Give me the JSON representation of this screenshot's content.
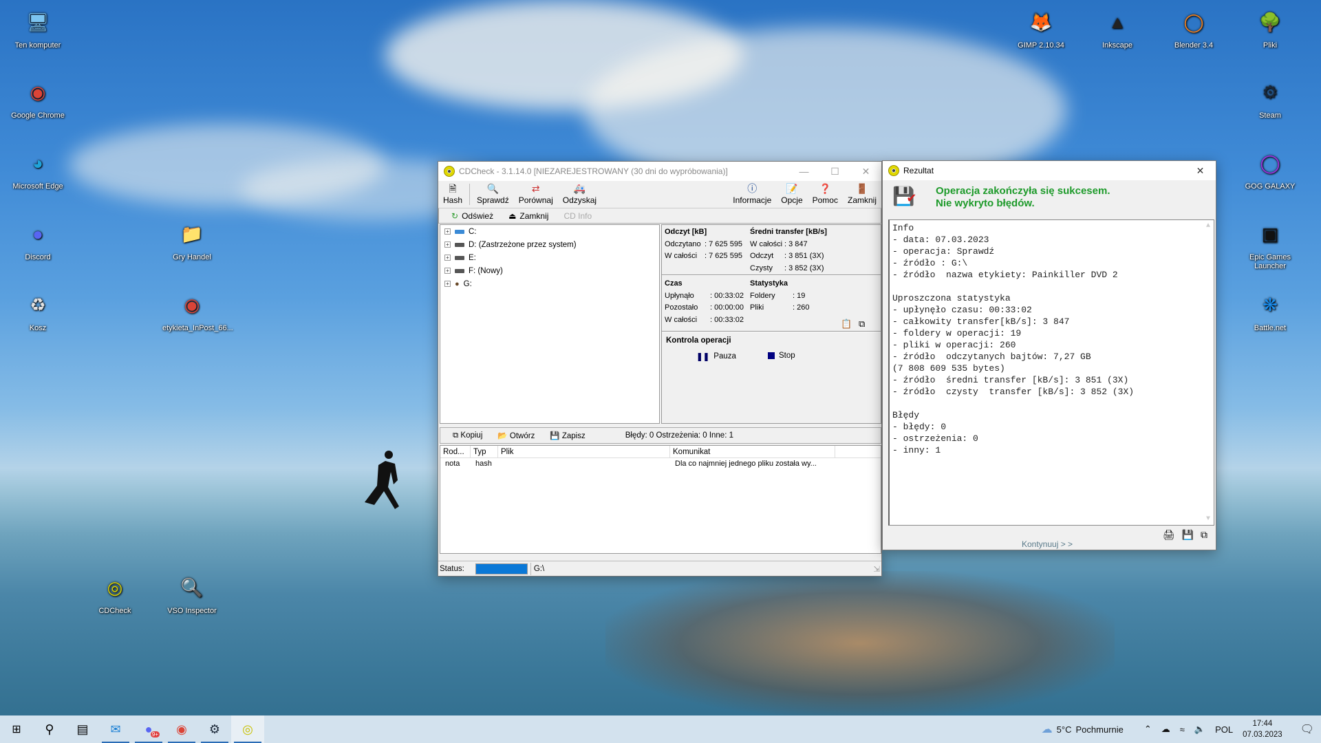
{
  "desktop": {
    "icons_left": [
      {
        "label": "Ten komputer",
        "icon": "computer-icon"
      },
      {
        "label": "Google Chrome",
        "icon": "chrome-icon"
      },
      {
        "label": "Microsoft Edge",
        "icon": "edge-icon"
      },
      {
        "label": "Discord",
        "icon": "discord-icon"
      },
      {
        "label": "Kosz",
        "icon": "recycle-bin-icon"
      },
      {
        "label": "Gry Handel",
        "icon": "folder-icon"
      },
      {
        "label": "etykieta_InPost_66...",
        "icon": "chrome-icon"
      },
      {
        "label": "CDCheck",
        "icon": "cdcheck-icon"
      },
      {
        "label": "VSO Inspector",
        "icon": "vso-inspector-icon"
      }
    ],
    "icons_right": [
      {
        "label": "GIMP 2.10.34",
        "icon": "gimp-icon"
      },
      {
        "label": "Inkscape",
        "icon": "inkscape-icon"
      },
      {
        "label": "Blender 3.4",
        "icon": "blender-icon"
      },
      {
        "label": "Pliki",
        "icon": "tree-folder-icon"
      },
      {
        "label": "Steam",
        "icon": "steam-icon"
      },
      {
        "label": "GOG GALAXY",
        "icon": "gog-galaxy-icon"
      },
      {
        "label": "Epic Games Launcher",
        "icon": "epic-games-icon"
      },
      {
        "label": "Battle.net",
        "icon": "battlenet-icon"
      }
    ]
  },
  "main_window": {
    "title": "CDCheck - 3.1.14.0 [NIEZAREJESTROWANY (30 dni do wypróbowania)]",
    "toolbar_left": [
      "Hash",
      "Sprawdź",
      "Porównaj",
      "Odzyskaj"
    ],
    "toolbar_right": [
      "Informacje",
      "Opcje",
      "Pomoc",
      "Zamknij"
    ],
    "subbar": {
      "refresh": "Odśwież",
      "close": "Zamknij",
      "cdinfo": "CD Info"
    },
    "drives": [
      "C:",
      "D: (Zastrzeżone przez system)",
      "E:",
      "F: (Nowy)",
      "G:"
    ],
    "read": {
      "title": "Odczyt [kB]",
      "rows": [
        {
          "k": "Odczytano",
          "v": ": 7 625 595"
        },
        {
          "k": "W całości",
          "v": ": 7 625 595"
        }
      ]
    },
    "transfer": {
      "title": "Średni transfer [kB/s]",
      "rows": [
        {
          "k": "W całości",
          "v": ": 3 847"
        },
        {
          "k": "Odczyt",
          "v": ": 3 851 (3X)"
        },
        {
          "k": "Czysty",
          "v": ": 3 852 (3X)"
        }
      ]
    },
    "time": {
      "title": "Czas",
      "rows": [
        {
          "k": "Upłynąło",
          "v": ": 00:33:02"
        },
        {
          "k": "Pozostało",
          "v": ": 00:00:00"
        },
        {
          "k": "W całości",
          "v": ": 00:33:02"
        }
      ]
    },
    "stats": {
      "title": "Statystyka",
      "rows": [
        {
          "k": "Foldery",
          "v": ": 19"
        },
        {
          "k": "Pliki",
          "v": ": 260"
        }
      ]
    },
    "control": {
      "title": "Kontrola operacji",
      "pause": "Pauza",
      "stop": "Stop"
    },
    "lowbar": {
      "copy": "Kopiuj",
      "open": "Otwórz",
      "save": "Zapisz",
      "summary": "Błędy: 0 Ostrzeżenia: 0 Inne: 1"
    },
    "list": {
      "columns": [
        "Rod...",
        "Typ",
        "Plik",
        "Komunikat"
      ],
      "rows": [
        [
          "nota",
          "hash",
          "",
          "Dla co najmniej jednego pliku została wy..."
        ]
      ]
    },
    "status": {
      "label": "Status:",
      "progress": 1.0,
      "path": "G:\\"
    }
  },
  "result_window": {
    "title": "Rezultat",
    "msg1": "Operacja zakończyła się sukcesem.",
    "msg2": "Nie wykryto błędów.",
    "text": "Info\n- data: 07.03.2023\n- operacja: Sprawdź\n- źródło : G:\\\n- źródło  nazwa etykiety: Painkiller DVD 2\n\nUproszczona statystyka\n- upłynęło czasu: 00:33:02\n- całkowity transfer[kB/s]: 3 847\n- foldery w operacji: 19\n- pliki w operacji: 260\n- źródło  odczytanych bajtów: 7,27 GB\n(7 808 609 535 bytes)\n- źródło  średni transfer [kB/s]: 3 851 (3X)\n- źródło  czysty  transfer [kB/s]: 3 852 (3X)\n\nBłędy\n- błędy: 0\n- ostrzeżenia: 0\n- inny: 1",
    "continue": "Kontynuuj > >"
  },
  "taskbar": {
    "weather_temp": "5°C",
    "weather_desc": "Pochmurnie",
    "lang": "POL",
    "time": "17:44",
    "date": "07.03.2023",
    "discord_badge": "9+"
  }
}
